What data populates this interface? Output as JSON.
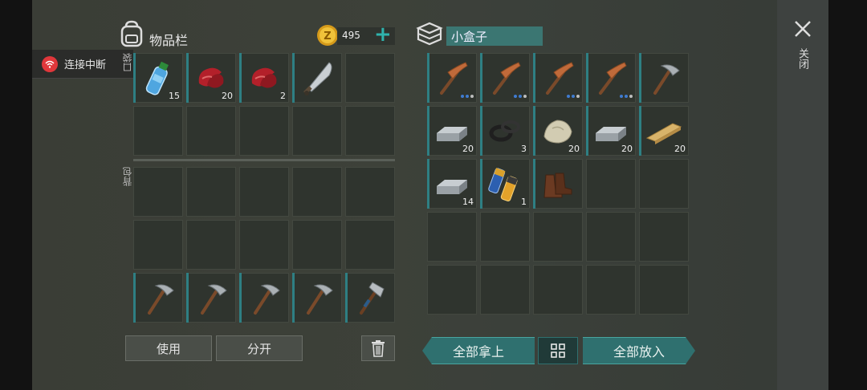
{
  "header": {
    "inventory_title": "物品栏",
    "coin_count": "495",
    "plus_label": "+",
    "box_name": "小盒子",
    "close_label": "关闭"
  },
  "status": {
    "connection": "连接中断"
  },
  "side_labels": {
    "pocket": "口袋",
    "backpack": "背包"
  },
  "colors": {
    "accent": "#2f706f",
    "alert": "#e0373b",
    "slot": "#2f342e"
  },
  "pocket": [
    {
      "icon": "water-bottle-icon",
      "count": "15"
    },
    {
      "icon": "raw-meat-icon",
      "count": "20"
    },
    {
      "icon": "raw-meat-icon",
      "count": "2"
    },
    {
      "icon": "machete-icon",
      "count": ""
    },
    {
      "icon": "",
      "count": ""
    },
    {
      "icon": "",
      "count": ""
    },
    {
      "icon": "",
      "count": ""
    },
    {
      "icon": "",
      "count": ""
    },
    {
      "icon": "",
      "count": ""
    },
    {
      "icon": "",
      "count": ""
    }
  ],
  "backpack": [
    {
      "icon": "",
      "count": ""
    },
    {
      "icon": "",
      "count": ""
    },
    {
      "icon": "",
      "count": ""
    },
    {
      "icon": "",
      "count": ""
    },
    {
      "icon": "",
      "count": ""
    },
    {
      "icon": "",
      "count": ""
    },
    {
      "icon": "",
      "count": ""
    },
    {
      "icon": "",
      "count": ""
    },
    {
      "icon": "",
      "count": ""
    },
    {
      "icon": "",
      "count": ""
    },
    {
      "icon": "pickaxe-icon",
      "count": ""
    },
    {
      "icon": "pickaxe-icon",
      "count": ""
    },
    {
      "icon": "pickaxe-icon",
      "count": ""
    },
    {
      "icon": "pickaxe-icon",
      "count": ""
    },
    {
      "icon": "hatchet-icon",
      "count": ""
    }
  ],
  "box": [
    {
      "icon": "copper-pickaxe-icon",
      "count": "",
      "durability": "3"
    },
    {
      "icon": "copper-pickaxe-icon",
      "count": "",
      "durability": "3"
    },
    {
      "icon": "copper-pickaxe-icon",
      "count": "",
      "durability": "3"
    },
    {
      "icon": "copper-pickaxe-icon",
      "count": "",
      "durability": "3"
    },
    {
      "icon": "pickaxe-icon",
      "count": "",
      "durability": ""
    },
    {
      "icon": "iron-ingot-icon",
      "count": "20"
    },
    {
      "icon": "rubber-rings-icon",
      "count": "3"
    },
    {
      "icon": "stone-icon",
      "count": "20"
    },
    {
      "icon": "iron-ingot-icon",
      "count": "20"
    },
    {
      "icon": "wood-plank-icon",
      "count": "20"
    },
    {
      "icon": "iron-ingot-icon",
      "count": "14"
    },
    {
      "icon": "battery-icon",
      "count": "1"
    },
    {
      "icon": "boots-icon",
      "count": ""
    },
    {
      "icon": "",
      "count": ""
    },
    {
      "icon": "",
      "count": ""
    },
    {
      "icon": "",
      "count": ""
    },
    {
      "icon": "",
      "count": ""
    },
    {
      "icon": "",
      "count": ""
    },
    {
      "icon": "",
      "count": ""
    },
    {
      "icon": "",
      "count": ""
    },
    {
      "icon": "",
      "count": ""
    },
    {
      "icon": "",
      "count": ""
    },
    {
      "icon": "",
      "count": ""
    },
    {
      "icon": "",
      "count": ""
    },
    {
      "icon": "",
      "count": ""
    }
  ],
  "actions": {
    "use": "使用",
    "split": "分开",
    "take_all": "全部拿上",
    "put_all": "全部放入"
  }
}
